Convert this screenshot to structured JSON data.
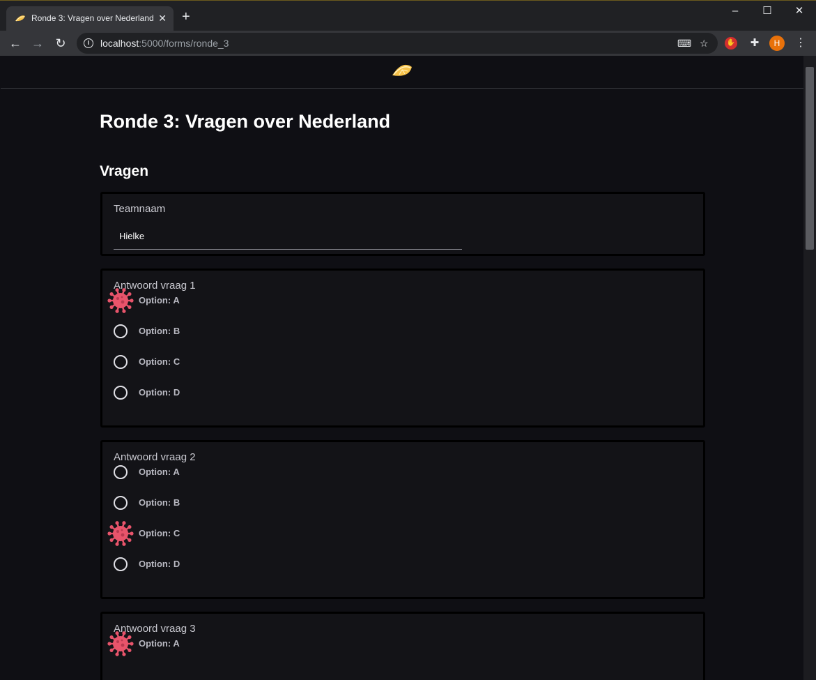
{
  "browser": {
    "tab_title": "Ronde 3: Vragen over Nederland",
    "url_host": "localhost",
    "url_rest": ":5000/forms/ronde_3",
    "profile_initial": "H"
  },
  "page": {
    "title": "Ronde 3: Vragen over Nederland",
    "section": "Vragen"
  },
  "teamname": {
    "label": "Teamnaam",
    "value": "Hielke"
  },
  "questions": [
    {
      "label": "Antwoord vraag 1",
      "options": [
        "Option: A",
        "Option: B",
        "Option: C",
        "Option: D"
      ],
      "selected": 0
    },
    {
      "label": "Antwoord vraag 2",
      "options": [
        "Option: A",
        "Option: B",
        "Option: C",
        "Option: D"
      ],
      "selected": 2
    },
    {
      "label": "Antwoord vraag 3",
      "options": [
        "Option: A"
      ],
      "selected": 0
    }
  ],
  "colors": {
    "selected_marker": "#e8546b",
    "background": "#0f0f14"
  },
  "icons": {
    "selected_marker": "virus-icon",
    "logo": "lemon-slice-icon"
  }
}
